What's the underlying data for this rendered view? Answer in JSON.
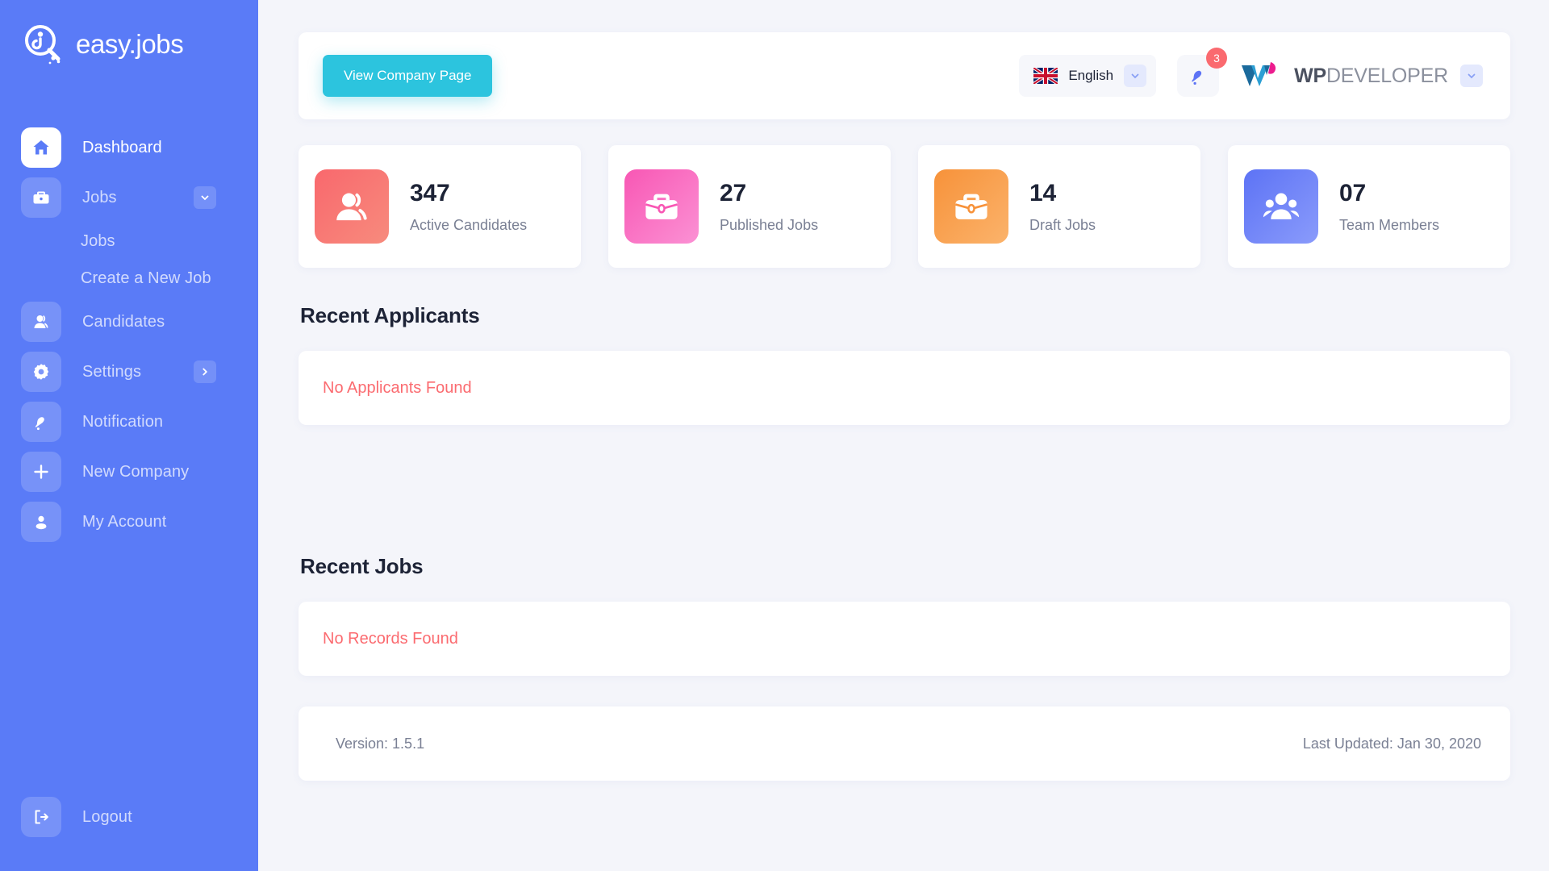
{
  "brand": {
    "logo_text": "easy.jobs"
  },
  "sidebar": {
    "items": [
      {
        "label": "Dashboard",
        "icon": "home-icon",
        "active": true
      },
      {
        "label": "Jobs",
        "icon": "briefcase-icon",
        "chevron": "chevron-down-icon"
      },
      {
        "label": "Jobs",
        "sub": true
      },
      {
        "label": "Create a New Job",
        "sub": true
      },
      {
        "label": "Candidates",
        "icon": "user-icon"
      },
      {
        "label": "Settings",
        "icon": "gear-icon",
        "chevron": "chevron-right-icon"
      },
      {
        "label": "Notification",
        "icon": "bell-icon"
      },
      {
        "label": "New Company",
        "icon": "plus-icon"
      },
      {
        "label": "My Account",
        "icon": "account-icon"
      }
    ],
    "logout": {
      "label": "Logout",
      "icon": "logout-icon"
    },
    "bg_color": "#5a7bf7"
  },
  "topbar": {
    "view_company_label": "View Company Page",
    "view_company_color": "#2cc4de",
    "language": {
      "name": "English",
      "flag": "uk-flag-icon",
      "chevron": "chevron-down-icon"
    },
    "notification": {
      "icon": "bell-icon",
      "count": "3",
      "badge_color": "#fa6a6f"
    },
    "account": {
      "wp": "WP",
      "developer": "DEVELOPER",
      "chevron": "chevron-down-icon"
    }
  },
  "stats": [
    {
      "value": "347",
      "label": "Active Candidates",
      "icon": "users-icon",
      "color_from": "#f9686d",
      "color_to": "#f78b7d"
    },
    {
      "value": "27",
      "label": "Published Jobs",
      "icon": "briefcase-icon",
      "color_from": "#f857b4",
      "color_to": "#fb91d4"
    },
    {
      "value": "14",
      "label": "Draft Jobs",
      "icon": "briefcase-icon",
      "color_from": "#f7923a",
      "color_to": "#fbb36b"
    },
    {
      "value": "07",
      "label": "Team Members",
      "icon": "group-icon",
      "color_from": "#5d73f5",
      "color_to": "#8a9bfb"
    }
  ],
  "recent_applicants": {
    "title": "Recent Applicants",
    "empty_text": "No Applicants Found"
  },
  "recent_jobs": {
    "title": "Recent Jobs",
    "empty_text": "No Records Found"
  },
  "footer": {
    "version": "Version: 1.5.1",
    "last_updated": "Last Updated: Jan 30, 2020"
  }
}
